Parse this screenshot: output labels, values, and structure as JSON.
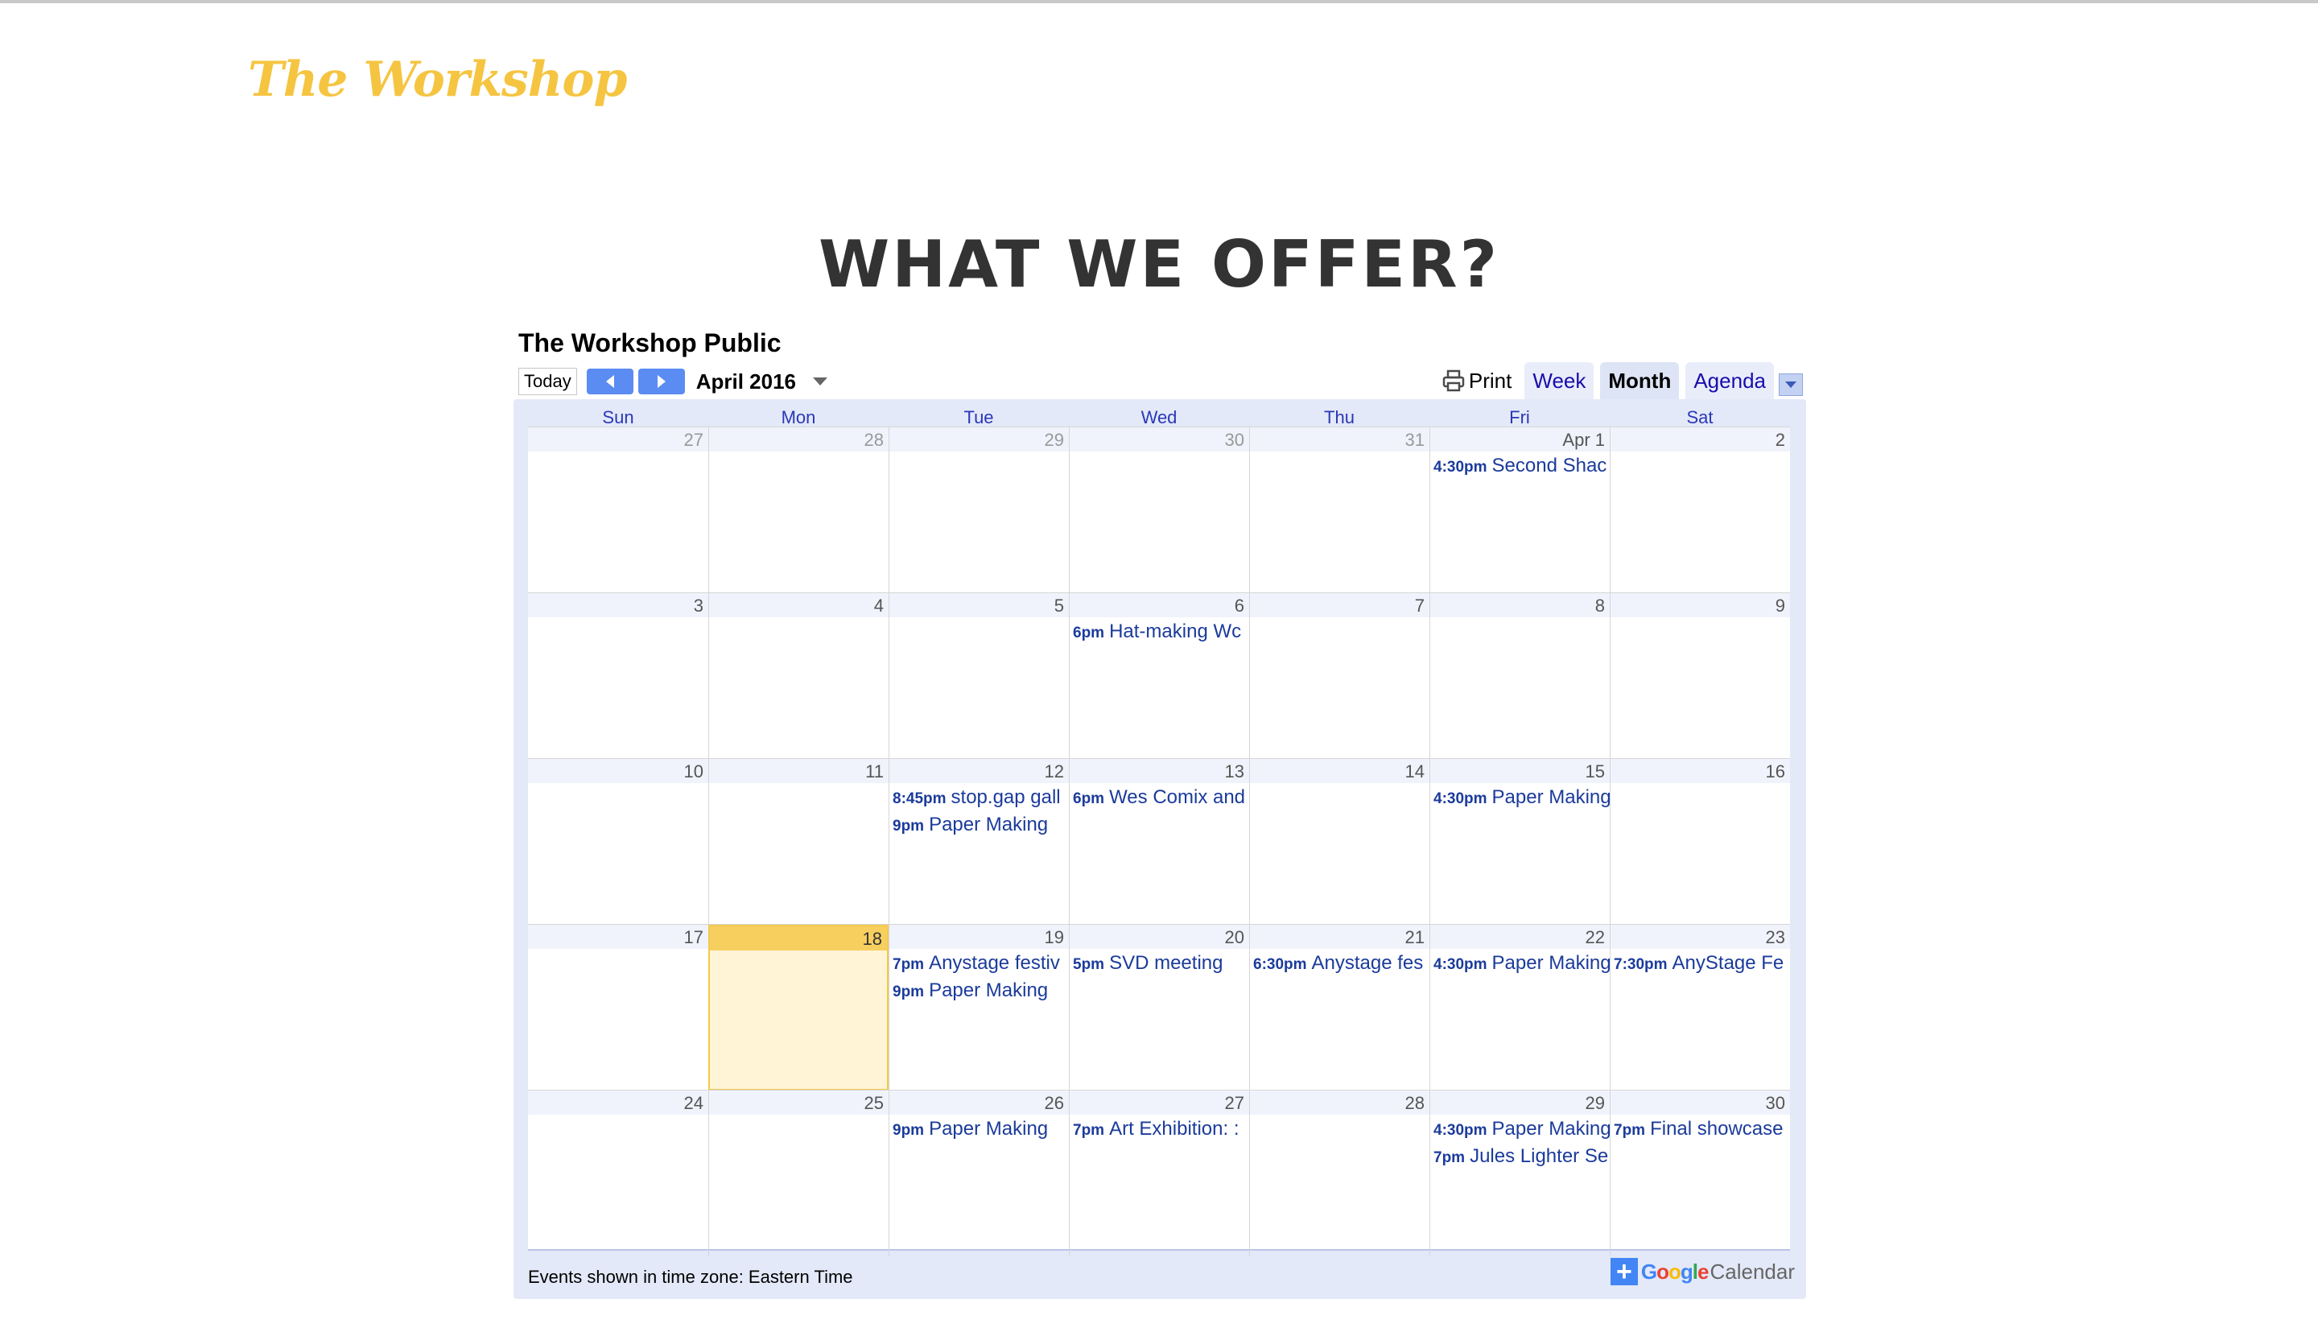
{
  "site": {
    "brand": "The Workshop",
    "heading": "WHAT WE OFFER?"
  },
  "calendar": {
    "title": "The Workshop Public",
    "today_label": "Today",
    "month_label": "April 2016",
    "print_label": "Print",
    "views": [
      "Week",
      "Month",
      "Agenda"
    ],
    "active_view": "Month",
    "weekdays": [
      "Sun",
      "Mon",
      "Tue",
      "Wed",
      "Thu",
      "Fri",
      "Sat"
    ],
    "weeks": [
      [
        {
          "date": "27",
          "other": true,
          "events": []
        },
        {
          "date": "28",
          "other": true,
          "events": []
        },
        {
          "date": "29",
          "other": true,
          "events": []
        },
        {
          "date": "30",
          "other": true,
          "events": []
        },
        {
          "date": "31",
          "other": true,
          "events": []
        },
        {
          "date": "Apr 1",
          "events": [
            {
              "time": "4:30pm",
              "title": "Second Shac"
            }
          ]
        },
        {
          "date": "2",
          "events": []
        }
      ],
      [
        {
          "date": "3",
          "events": []
        },
        {
          "date": "4",
          "events": []
        },
        {
          "date": "5",
          "events": []
        },
        {
          "date": "6",
          "events": [
            {
              "time": "6pm",
              "title": "Hat-making Wc"
            }
          ]
        },
        {
          "date": "7",
          "events": []
        },
        {
          "date": "8",
          "events": []
        },
        {
          "date": "9",
          "events": []
        }
      ],
      [
        {
          "date": "10",
          "events": []
        },
        {
          "date": "11",
          "events": []
        },
        {
          "date": "12",
          "events": [
            {
              "time": "8:45pm",
              "title": "stop.gap gall"
            },
            {
              "time": "9pm",
              "title": "Paper Making"
            }
          ]
        },
        {
          "date": "13",
          "events": [
            {
              "time": "6pm",
              "title": "Wes Comix and"
            }
          ]
        },
        {
          "date": "14",
          "events": []
        },
        {
          "date": "15",
          "events": [
            {
              "time": "4:30pm",
              "title": "Paper Making"
            }
          ]
        },
        {
          "date": "16",
          "events": []
        }
      ],
      [
        {
          "date": "17",
          "events": []
        },
        {
          "date": "18",
          "today": true,
          "events": []
        },
        {
          "date": "19",
          "events": [
            {
              "time": "7pm",
              "title": "Anystage festiv"
            },
            {
              "time": "9pm",
              "title": "Paper Making"
            }
          ]
        },
        {
          "date": "20",
          "events": [
            {
              "time": "5pm",
              "title": "SVD meeting"
            }
          ]
        },
        {
          "date": "21",
          "events": [
            {
              "time": "6:30pm",
              "title": "Anystage fes"
            }
          ]
        },
        {
          "date": "22",
          "events": [
            {
              "time": "4:30pm",
              "title": "Paper Making"
            }
          ]
        },
        {
          "date": "23",
          "events": [
            {
              "time": "7:30pm",
              "title": "AnyStage Fe"
            }
          ]
        }
      ],
      [
        {
          "date": "24",
          "events": []
        },
        {
          "date": "25",
          "events": []
        },
        {
          "date": "26",
          "events": [
            {
              "time": "9pm",
              "title": "Paper Making"
            }
          ]
        },
        {
          "date": "27",
          "events": [
            {
              "time": "7pm",
              "title": "Art Exhibition: :"
            }
          ]
        },
        {
          "date": "28",
          "events": []
        },
        {
          "date": "29",
          "events": [
            {
              "time": "4:30pm",
              "title": "Paper Making"
            },
            {
              "time": "7pm",
              "title": "Jules Lighter Se"
            }
          ]
        },
        {
          "date": "30",
          "events": [
            {
              "time": "7pm",
              "title": "Final showcase"
            }
          ]
        }
      ]
    ],
    "timezone_note": "Events shown in time zone: Eastern Time",
    "badge": {
      "plus": "+",
      "google": "Google",
      "calendar": "Calendar"
    },
    "colors": {
      "nav_button": "#5b8cf2",
      "today_cell": "#fff5d6",
      "today_header": "#f7cf5f",
      "event_text": "#1b3b9b",
      "brand": "#f5c542"
    },
    "icons": {
      "prev": "chevron-left-icon",
      "next": "chevron-right-icon",
      "print": "printer-icon",
      "month_menu": "triangle-down-icon",
      "view_menu": "triangle-down-icon",
      "add": "plus-icon"
    }
  }
}
